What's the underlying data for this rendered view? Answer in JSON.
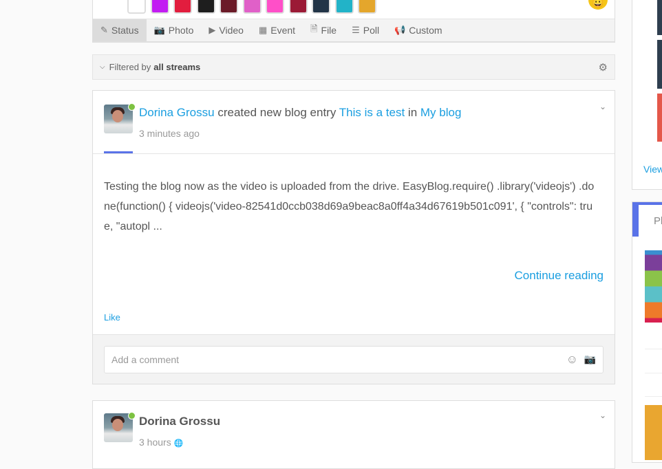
{
  "composer": {
    "swatches": [
      "#ffffff",
      "#c21cf2",
      "#e21d3e",
      "#1e1e1e",
      "#6b1b28",
      "#e060c8",
      "#ff4fc8",
      "#9b1a36",
      "#223447",
      "#22b3c8",
      "#e4a62c"
    ],
    "tabs": [
      {
        "label": "Status",
        "icon": "pencil-icon",
        "glyph": "✎"
      },
      {
        "label": "Photo",
        "icon": "camera-icon",
        "glyph": "📷"
      },
      {
        "label": "Video",
        "icon": "video-icon",
        "glyph": "▶"
      },
      {
        "label": "Event",
        "icon": "calendar-icon",
        "glyph": "▦"
      },
      {
        "label": "File",
        "icon": "file-icon",
        "glyph": "🗎"
      },
      {
        "label": "Poll",
        "icon": "list-icon",
        "glyph": "☰"
      },
      {
        "label": "Custom",
        "icon": "megaphone-icon",
        "glyph": "📢"
      }
    ]
  },
  "filter": {
    "prefix": "Filtered by",
    "value": "all streams"
  },
  "post1": {
    "author": "Dorina Grossu",
    "action": "created new blog entry",
    "title": "This is a test",
    "in": "in",
    "blog": "My blog",
    "time": "3 minutes ago",
    "body": "Testing the blog now as the video is uploaded from the drive. EasyBlog.require() .library('videojs') .done(function() { videojs('video-82541d0ccb038d69a9beac8a0ff4a34d67619b501c091', { \"controls\": true, \"autopl ...",
    "continue": "Continue reading",
    "like": "Like",
    "comment_placeholder": "Add a comment"
  },
  "post2": {
    "author": "Dorina Grossu",
    "time": "3 hours"
  },
  "sidebar": {
    "view_link": "View",
    "panel_title": "Pl"
  },
  "colors": {
    "accent": "#1a9ee0",
    "tab_indicator": "#5a73e8"
  }
}
